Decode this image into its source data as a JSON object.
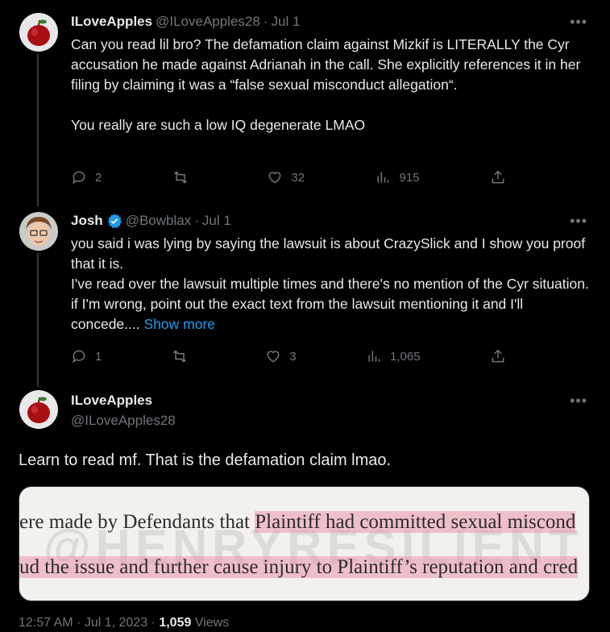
{
  "tweets": [
    {
      "name": "ILoveApples",
      "handle": "@ILoveApples28",
      "dot": "·",
      "time": "Jul 1",
      "more": "•••",
      "text_lines": [
        "Can you read lil bro? The defamation claim against Mizkif is LITERALLY the Cyr accusation he made against Adrianah in the call. She explicitly references it in her filing by claiming it was a “false sexual misconduct allegation“.",
        "You really are such a low IQ degenerate LMAO"
      ],
      "replies": "2",
      "retweets": "",
      "likes": "32",
      "views": "915"
    },
    {
      "name": "Josh",
      "handle": "@Bowblax",
      "dot": "·",
      "time": "Jul 1",
      "more": "•••",
      "text_lines": [
        "you said i was lying by saying the lawsuit is about CrazySlick and I show you proof that it is.",
        "I've read over the lawsuit multiple times and there's no mention of the Cyr situation. if I'm wrong, point out the exact text from the lawsuit mentioning it and I'll concede...."
      ],
      "show_more": "Show more",
      "replies": "1",
      "retweets": "",
      "likes": "3",
      "views": "1,065"
    }
  ],
  "main_tweet": {
    "name": "ILoveApples",
    "handle": "@ILoveApples28",
    "more": "•••",
    "text": "Learn to read mf. That is the defamation claim lmao.",
    "image": {
      "line1_plain": "ere made by Defendants that ",
      "line1_highlight": "Plaintiff had committed sexual miscond",
      "line2_highlight": "ud the issue and further cause injury to Plaintiff’s reputation and cred",
      "watermark": "@HENRYRESILIENT"
    },
    "footer": {
      "time": "12:57 AM · Jul 1, 2023 · ",
      "views_count": "1,059",
      "views_label": " Views"
    }
  },
  "colors": {
    "background": "#000000",
    "text": "#e7e9ea",
    "muted": "#71767b",
    "link": "#1d9bf0",
    "verified": "#1d9bf0"
  }
}
